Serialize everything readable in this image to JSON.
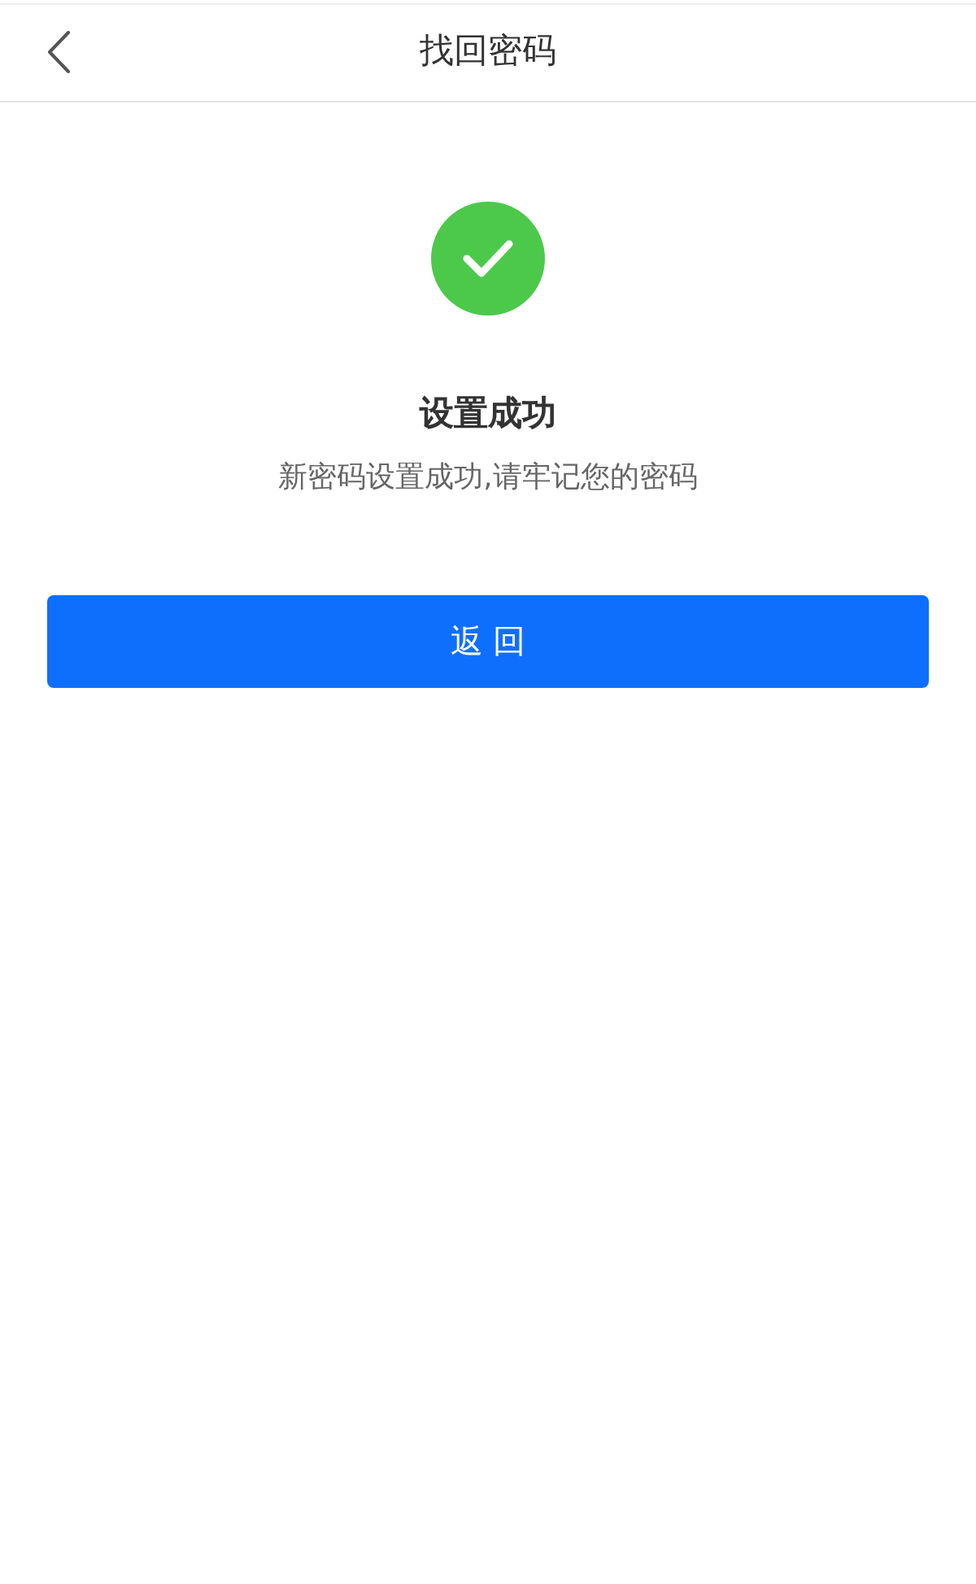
{
  "header": {
    "title": "找回密码"
  },
  "result": {
    "success": true,
    "title": "设置成功",
    "message": "新密码设置成功,请牢记您的密码"
  },
  "button": {
    "label": "返 回"
  }
}
